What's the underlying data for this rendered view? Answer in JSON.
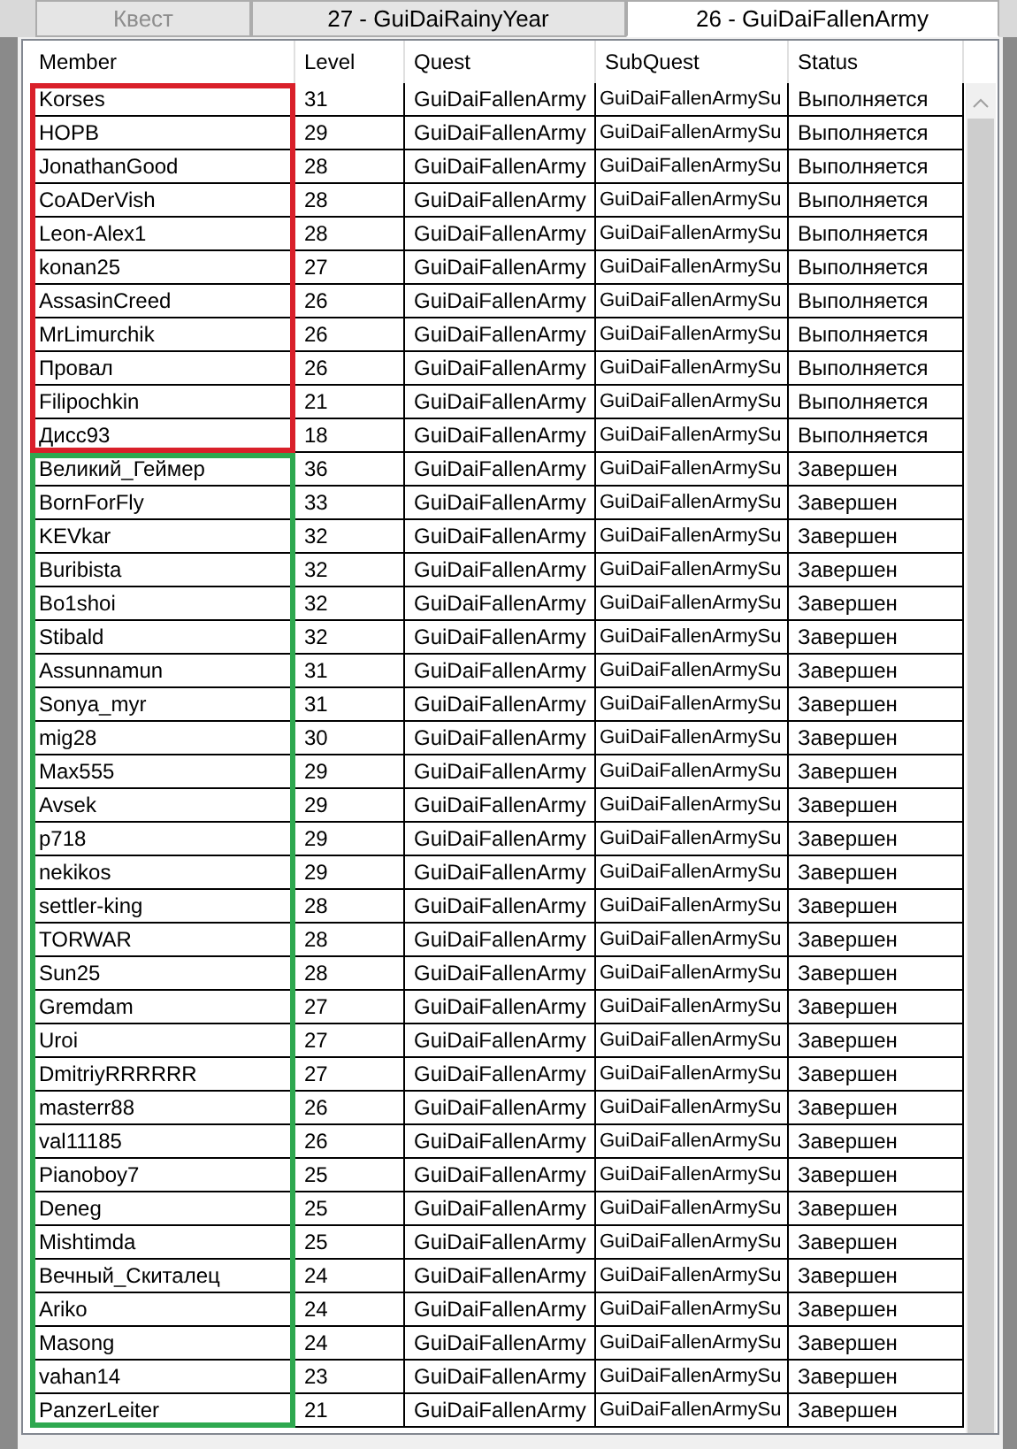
{
  "tabs": [
    {
      "label": "Квест",
      "selected": false,
      "disabled": true
    },
    {
      "label": "27 - GuiDaiRainyYear",
      "selected": false,
      "disabled": false
    },
    {
      "label": "26 - GuiDaiFallenArmy",
      "selected": true,
      "disabled": false
    }
  ],
  "table": {
    "columns": [
      "Member",
      "Level",
      "Quest",
      "SubQuest",
      "Status"
    ],
    "groups": [
      {
        "color": "#d9202a",
        "rows": [
          [
            "Korses",
            "31",
            "GuiDaiFallenArmy",
            "GuiDaiFallenArmySu",
            "Выполняется"
          ],
          [
            "HOPB",
            "29",
            "GuiDaiFallenArmy",
            "GuiDaiFallenArmySu",
            "Выполняется"
          ],
          [
            "JonathanGood",
            "28",
            "GuiDaiFallenArmy",
            "GuiDaiFallenArmySu",
            "Выполняется"
          ],
          [
            "CoADerVish",
            "28",
            "GuiDaiFallenArmy",
            "GuiDaiFallenArmySu",
            "Выполняется"
          ],
          [
            "Leon-Alex1",
            "28",
            "GuiDaiFallenArmy",
            "GuiDaiFallenArmySu",
            "Выполняется"
          ],
          [
            "konan25",
            "27",
            "GuiDaiFallenArmy",
            "GuiDaiFallenArmySu",
            "Выполняется"
          ],
          [
            "AssasinCreed",
            "26",
            "GuiDaiFallenArmy",
            "GuiDaiFallenArmySu",
            "Выполняется"
          ],
          [
            "MrLimurchik",
            "26",
            "GuiDaiFallenArmy",
            "GuiDaiFallenArmySu",
            "Выполняется"
          ],
          [
            "Провал",
            "26",
            "GuiDaiFallenArmy",
            "GuiDaiFallenArmySu",
            "Выполняется"
          ],
          [
            "Filipochkin",
            "21",
            "GuiDaiFallenArmy",
            "GuiDaiFallenArmySu",
            "Выполняется"
          ],
          [
            "Дисс93",
            "18",
            "GuiDaiFallenArmy",
            "GuiDaiFallenArmySu",
            "Выполняется"
          ]
        ]
      },
      {
        "color": "#2ea84f",
        "rows": [
          [
            "Великий_Геймер",
            "36",
            "GuiDaiFallenArmy",
            "GuiDaiFallenArmySu",
            "Завершен"
          ],
          [
            "BornForFly",
            "33",
            "GuiDaiFallenArmy",
            "GuiDaiFallenArmySu",
            "Завершен"
          ],
          [
            "KEVkar",
            "32",
            "GuiDaiFallenArmy",
            "GuiDaiFallenArmySu",
            "Завершен"
          ],
          [
            "Buribista",
            "32",
            "GuiDaiFallenArmy",
            "GuiDaiFallenArmySu",
            "Завершен"
          ],
          [
            "Bo1shoi",
            "32",
            "GuiDaiFallenArmy",
            "GuiDaiFallenArmySu",
            "Завершен"
          ],
          [
            "Stibald",
            "32",
            "GuiDaiFallenArmy",
            "GuiDaiFallenArmySu",
            "Завершен"
          ],
          [
            "Assunnamun",
            "31",
            "GuiDaiFallenArmy",
            "GuiDaiFallenArmySu",
            "Завершен"
          ],
          [
            "Sonya_myr",
            "31",
            "GuiDaiFallenArmy",
            "GuiDaiFallenArmySu",
            "Завершен"
          ],
          [
            "mig28",
            "30",
            "GuiDaiFallenArmy",
            "GuiDaiFallenArmySu",
            "Завершен"
          ],
          [
            "Max555",
            "29",
            "GuiDaiFallenArmy",
            "GuiDaiFallenArmySu",
            "Завершен"
          ],
          [
            "Avsek",
            "29",
            "GuiDaiFallenArmy",
            "GuiDaiFallenArmySu",
            "Завершен"
          ],
          [
            "p718",
            "29",
            "GuiDaiFallenArmy",
            "GuiDaiFallenArmySu",
            "Завершен"
          ],
          [
            "nekikos",
            "29",
            "GuiDaiFallenArmy",
            "GuiDaiFallenArmySu",
            "Завершен"
          ],
          [
            "settler-king",
            "28",
            "GuiDaiFallenArmy",
            "GuiDaiFallenArmySu",
            "Завершен"
          ],
          [
            "TORWAR",
            "28",
            "GuiDaiFallenArmy",
            "GuiDaiFallenArmySu",
            "Завершен"
          ],
          [
            "Sun25",
            "28",
            "GuiDaiFallenArmy",
            "GuiDaiFallenArmySu",
            "Завершен"
          ],
          [
            "Gremdam",
            "27",
            "GuiDaiFallenArmy",
            "GuiDaiFallenArmySu",
            "Завершен"
          ],
          [
            "Uroi",
            "27",
            "GuiDaiFallenArmy",
            "GuiDaiFallenArmySu",
            "Завершен"
          ],
          [
            "DmitriyRRRRRR",
            "27",
            "GuiDaiFallenArmy",
            "GuiDaiFallenArmySu",
            "Завершен"
          ],
          [
            "masterr88",
            "26",
            "GuiDaiFallenArmy",
            "GuiDaiFallenArmySu",
            "Завершен"
          ],
          [
            "val11185",
            "26",
            "GuiDaiFallenArmy",
            "GuiDaiFallenArmySu",
            "Завершен"
          ],
          [
            "Pianoboy7",
            "25",
            "GuiDaiFallenArmy",
            "GuiDaiFallenArmySu",
            "Завершен"
          ],
          [
            "Deneg",
            "25",
            "GuiDaiFallenArmy",
            "GuiDaiFallenArmySu",
            "Завершен"
          ],
          [
            "Mishtimda",
            "25",
            "GuiDaiFallenArmy",
            "GuiDaiFallenArmySu",
            "Завершен"
          ],
          [
            "Вечный_Скиталец",
            "24",
            "GuiDaiFallenArmy",
            "GuiDaiFallenArmySu",
            "Завершен"
          ],
          [
            "Ariko",
            "24",
            "GuiDaiFallenArmy",
            "GuiDaiFallenArmySu",
            "Завершен"
          ],
          [
            "Masong",
            "24",
            "GuiDaiFallenArmy",
            "GuiDaiFallenArmySu",
            "Завершен"
          ],
          [
            "vahan14",
            "23",
            "GuiDaiFallenArmy",
            "GuiDaiFallenArmySu",
            "Завершен"
          ],
          [
            "PanzerLeiter",
            "21",
            "GuiDaiFallenArmy",
            "GuiDaiFallenArmySu",
            "Завершен"
          ]
        ]
      }
    ]
  }
}
